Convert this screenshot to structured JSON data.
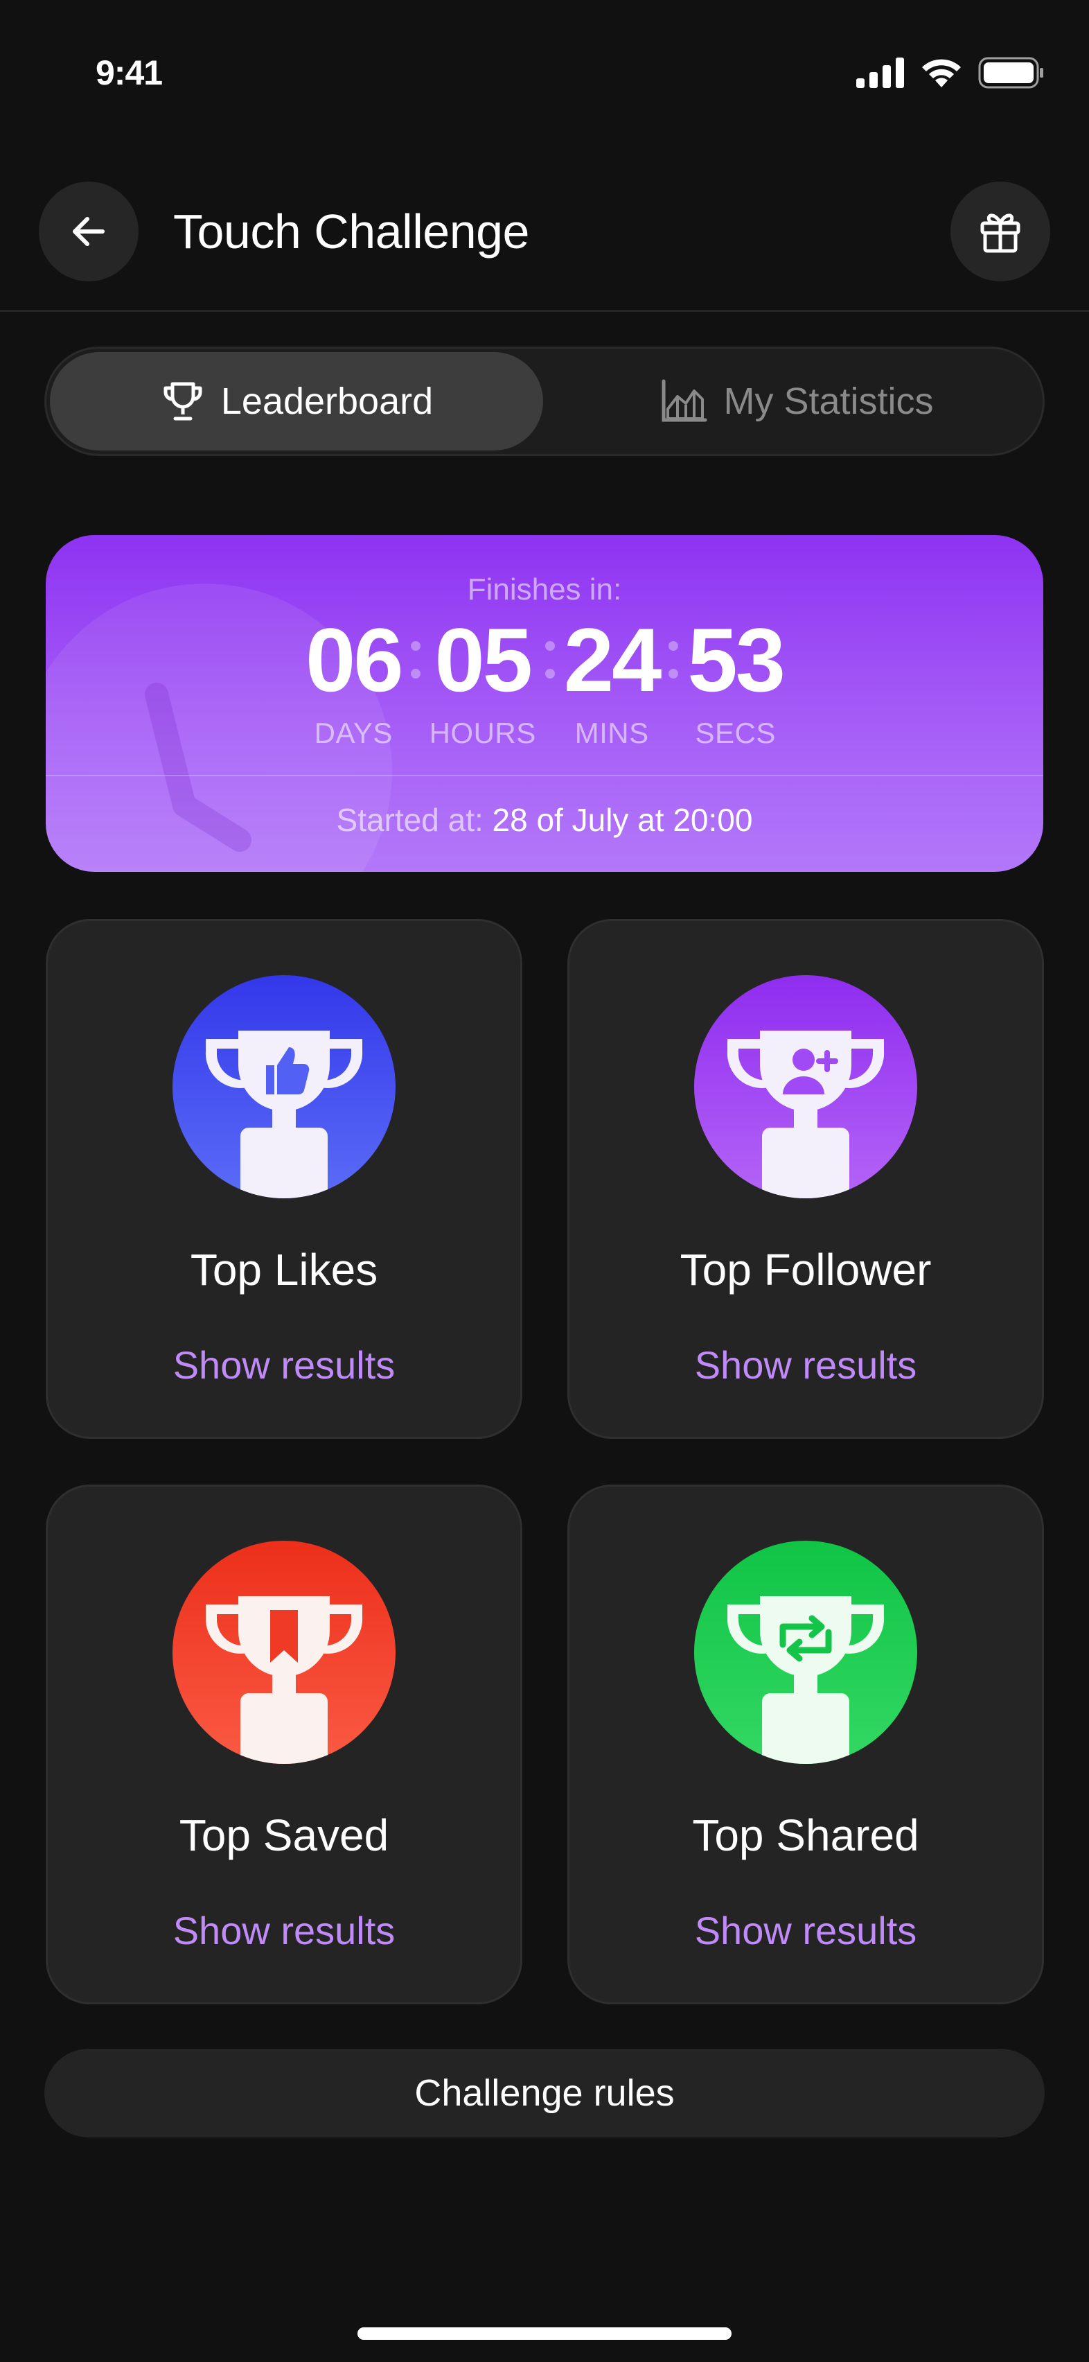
{
  "status_bar": {
    "time": "9:41"
  },
  "header": {
    "title": "Touch Challenge"
  },
  "tabs": [
    {
      "label": "Leaderboard",
      "active": true
    },
    {
      "label": "My Statistics",
      "active": false
    }
  ],
  "countdown": {
    "finishes_label": "Finishes in:",
    "units": [
      {
        "value": "06",
        "label": "DAYS"
      },
      {
        "value": "05",
        "label": "HOURS"
      },
      {
        "value": "24",
        "label": "MINS"
      },
      {
        "value": "53",
        "label": "SECS"
      }
    ],
    "started_prefix": "Started at:",
    "started_value": "28 of July at 20:00"
  },
  "categories": [
    {
      "title": "Top Likes",
      "link": "Show results",
      "icon": "thumbs-up-trophy-icon",
      "color": "#4657f3"
    },
    {
      "title": "Top Follower",
      "link": "Show results",
      "icon": "add-user-trophy-icon",
      "color": "#9b45f5"
    },
    {
      "title": "Top Saved",
      "link": "Show results",
      "icon": "bookmark-trophy-icon",
      "color": "#f0432e"
    },
    {
      "title": "Top Shared",
      "link": "Show results",
      "icon": "repost-trophy-icon",
      "color": "#1bce4e"
    }
  ],
  "footer": {
    "rules_label": "Challenge rules"
  },
  "colors": {
    "accent": "#a259f7",
    "link": "#c08bf8",
    "background": "#111111",
    "card": "#242424"
  }
}
